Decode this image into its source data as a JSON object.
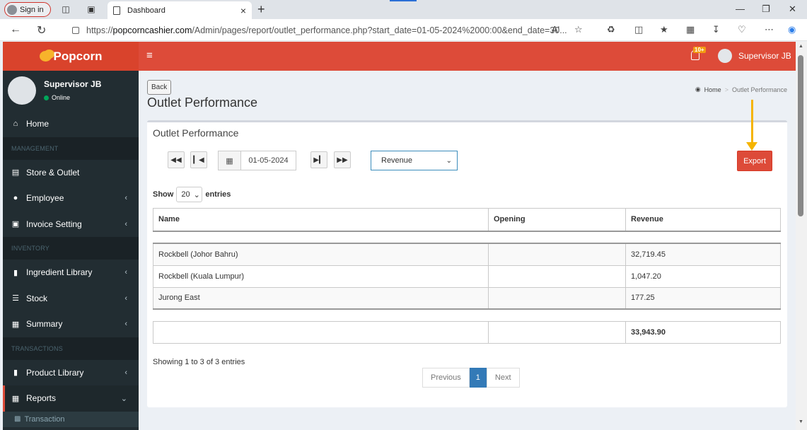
{
  "browser": {
    "signin_label": "Sign in",
    "tab_title": "Dashboard",
    "url_prefix": "https://",
    "url_domain": "popcorncashier.com",
    "url_path": "/Admin/pages/report/outlet_performance.php?start_date=01-05-2024%2000:00&end_date=30...",
    "read_aloud": "Aʹ"
  },
  "app": {
    "brand": "Popcorn",
    "notif_badge": "10+",
    "top_user": "Supervisor JB"
  },
  "sidebar": {
    "user_name": "Supervisor JB",
    "user_status": "Online",
    "items": {
      "home": "Home",
      "management": "MANAGEMENT",
      "store": "Store & Outlet",
      "employee": "Employee",
      "invoice": "Invoice Setting",
      "inventory": "INVENTORY",
      "ingredient": "Ingredient Library",
      "stock": "Stock",
      "summary": "Summary",
      "transactions": "TRANSACTIONS",
      "product": "Product Library",
      "reports": "Reports",
      "transaction_sub": "Transaction"
    }
  },
  "page": {
    "back_label": "Back",
    "title": "Outlet Performance",
    "breadcrumb_home": "Home",
    "breadcrumb_current": "Outlet Performance",
    "box_title": "Outlet Performance",
    "date_value": "01-05-2024",
    "metric_value": "Revenue",
    "export_label": "Export",
    "show_label": "Show",
    "entries_value": "20",
    "entries_label": "entries",
    "columns": [
      "Name",
      "Opening",
      "Revenue"
    ],
    "rows": [
      {
        "name": "Rockbell (Johor Bahru)",
        "opening": "",
        "revenue": "32,719.45"
      },
      {
        "name": "Rockbell (Kuala Lumpur)",
        "opening": "",
        "revenue": "1,047.20"
      },
      {
        "name": "Jurong East",
        "opening": "",
        "revenue": "177.25"
      }
    ],
    "total_revenue": "33,943.90",
    "info_text": "Showing 1 to 3 of 3 entries",
    "pager": {
      "prev": "Previous",
      "current": "1",
      "next": "Next"
    }
  }
}
